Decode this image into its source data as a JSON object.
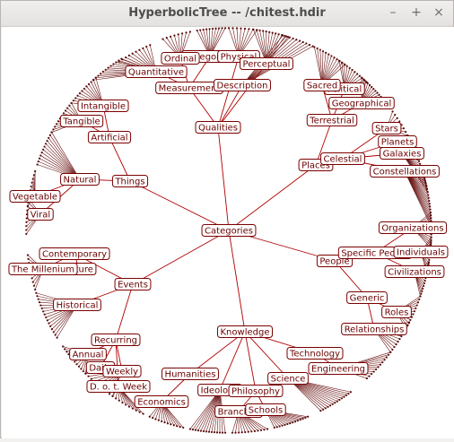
{
  "window": {
    "title": "HyperbolicTree -- /chitest.hdir",
    "minimize_glyph": "–",
    "maximize_glyph": "+",
    "close_glyph": "×"
  },
  "colors": {
    "edge": "#b00000",
    "label_text": "#6a0000",
    "leaf": "#5a0a0a"
  },
  "tree": {
    "root": "Categories",
    "nodes": {
      "categories": "Categories",
      "qualities": "Qualities",
      "measurement": "Measurement",
      "quantitative": "Quantitative",
      "ordinal": "Ordinal",
      "categorical": "Categorical",
      "physical": "Physical",
      "perceptual": "Perceptual",
      "description": "Description",
      "places": "Places",
      "terrestrial": "Terrestrial",
      "sacred": "Sacred",
      "political": "Political",
      "geographical": "Geographical",
      "celestial": "Celestial",
      "stars": "Stars",
      "planets": "Planets",
      "galaxies": "Galaxies",
      "constellations": "Constellations",
      "people": "People",
      "specific_people": "Specific People",
      "organizations": "Organizations",
      "individuals": "Individuals",
      "civilizations": "Civilizations",
      "generic": "Generic",
      "roles": "Roles",
      "relationships": "Relationships",
      "knowledge": "Knowledge",
      "technology": "Technology",
      "engineering": "Engineering",
      "science": "Science",
      "humanities": "Humanities",
      "ideology": "Ideology",
      "philosophy": "Philosophy",
      "branches": "Branches",
      "schools": "Schools",
      "economics": "Economics",
      "events": "Events",
      "contemporary": "Contemporary",
      "the_millenium": "The Millenium",
      "future": "Future",
      "historical": "Historical",
      "recurring": "Recurring",
      "annual": "Annual",
      "daily": "Daily",
      "weekly": "Weekly",
      "day_of_week": "D. o. t. Week",
      "things": "Things",
      "artificial": "Artificial",
      "tangible": "Tangible",
      "intangible": "Intangible",
      "natural": "Natural",
      "vegetable": "Vegetable",
      "viral": "Viral"
    }
  }
}
